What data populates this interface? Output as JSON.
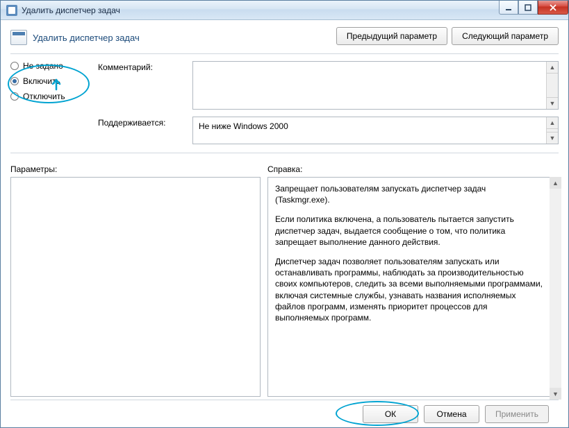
{
  "window": {
    "title": "Удалить диспетчер задач"
  },
  "header": {
    "policy_title": "Удалить диспетчер задач",
    "prev_button": "Предыдущий параметр",
    "next_button": "Следующий параметр"
  },
  "state": {
    "options": {
      "not_configured": "Не задано",
      "enabled": "Включить",
      "disabled": "Отключить"
    },
    "selected": "enabled"
  },
  "labels": {
    "comment": "Комментарий:",
    "supported": "Поддерживается:",
    "options_section": "Параметры:",
    "help_section": "Справка:"
  },
  "fields": {
    "comment": "",
    "supported": "Не ниже Windows 2000"
  },
  "help": {
    "p1": "Запрещает пользователям запускать диспетчер задач (Taskmgr.exe).",
    "p2": "Если политика включена, а пользователь пытается запустить диспетчер задач, выдается сообщение о том, что политика запрещает выполнение данного действия.",
    "p3": "Диспетчер задач позволяет пользователям запускать или останавливать программы, наблюдать за производительностью своих компьютеров, следить за всеми выполняемыми программами, включая системные службы, узнавать названия исполняемых файлов программ, изменять приоритет процессов для выполняемых программ."
  },
  "footer": {
    "ok": "ОК",
    "cancel": "Отмена",
    "apply": "Применить"
  }
}
